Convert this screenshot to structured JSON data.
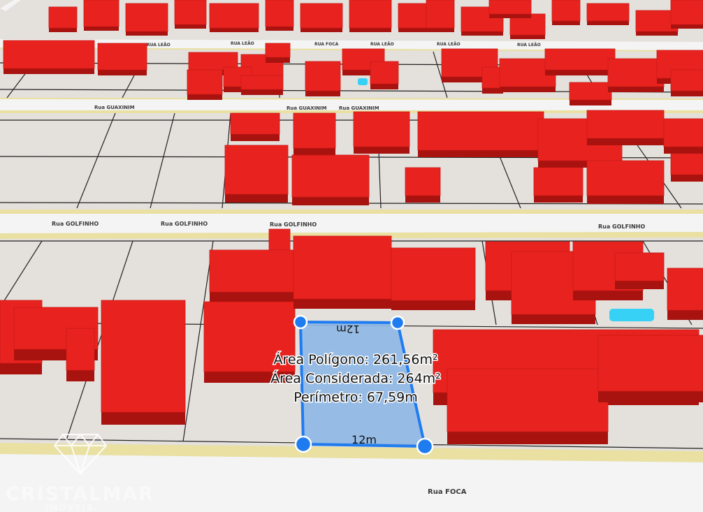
{
  "streets": {
    "top_small": [
      "RUA LEÃO",
      "RUA FOCA",
      "RUA LEÃO",
      "RUA LEÃO",
      "RUA LEÃO"
    ],
    "guaxinim": [
      "Rua GUAXINIM",
      "Rua GUAXINIM",
      "Rua GUAXINIM"
    ],
    "golfinho": [
      "Rua GOLFINHO",
      "Rua GOLFINHO",
      "Rua GOLFINHO",
      "Rua GOLFINHO"
    ],
    "foca": "Rua FOCA"
  },
  "lot": {
    "top_dimension": "12m",
    "bottom_dimension": "12m",
    "area_polygon": "Área Polígono: 261,56m²",
    "area_considered": "Área Considerada: 264m²",
    "perimeter": "Perímetro: 67,59m"
  },
  "logo": {
    "name": "CRISTALMAR",
    "tagline": "IMÓVEIS"
  },
  "colors": {
    "building": "#e8231f",
    "building_side": "#a8120f",
    "ground": "#e4e0dc",
    "road": "#f4f4f4",
    "road_edge": "#e9e0a2",
    "lot_fill": "#8fb8e6",
    "lot_border": "#1f7cf0",
    "pool": "#36d1f5"
  }
}
